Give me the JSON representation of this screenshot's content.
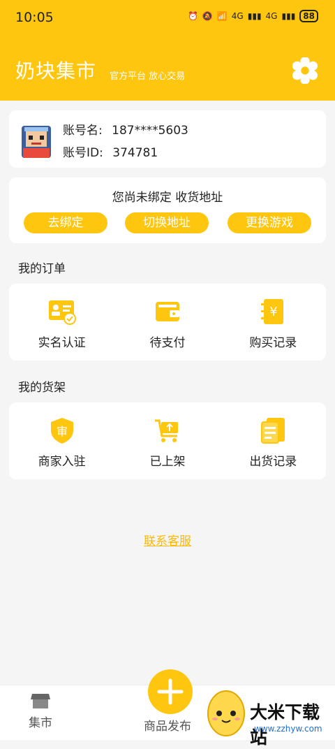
{
  "statusbar": {
    "time": "10:05",
    "battery": "88",
    "net1": "4G",
    "net2": "4G"
  },
  "header": {
    "title": "奶块集市",
    "slogan": "官方平台 放心交易"
  },
  "account": {
    "name_label": "账号名:",
    "name_value": "187****5603",
    "id_label": "账号ID:",
    "id_value": "374781"
  },
  "bind": {
    "notice": "您尚未绑定 收货地址",
    "btn_bind": "去绑定",
    "btn_switch": "切换地址",
    "btn_game": "更换游戏"
  },
  "orders": {
    "title": "我的订单",
    "items": [
      {
        "label": "实名认证",
        "icon": "id-card-icon"
      },
      {
        "label": "待支付",
        "icon": "wallet-icon"
      },
      {
        "label": "购买记录",
        "icon": "purchase-record-icon"
      }
    ]
  },
  "shelf": {
    "title": "我的货架",
    "items": [
      {
        "label": "商家入驻",
        "icon": "merchant-shield-icon"
      },
      {
        "label": "已上架",
        "icon": "cart-upload-icon"
      },
      {
        "label": "出货记录",
        "icon": "shipment-record-icon"
      }
    ]
  },
  "contact": "联系客服",
  "tabbar": {
    "market": "集市",
    "publish": "商品发布"
  },
  "watermark": {
    "brand": "大米下载站",
    "url": "www.zzhyw.com"
  },
  "colors": {
    "accent": "#ffc60f",
    "link": "#ffb800"
  }
}
